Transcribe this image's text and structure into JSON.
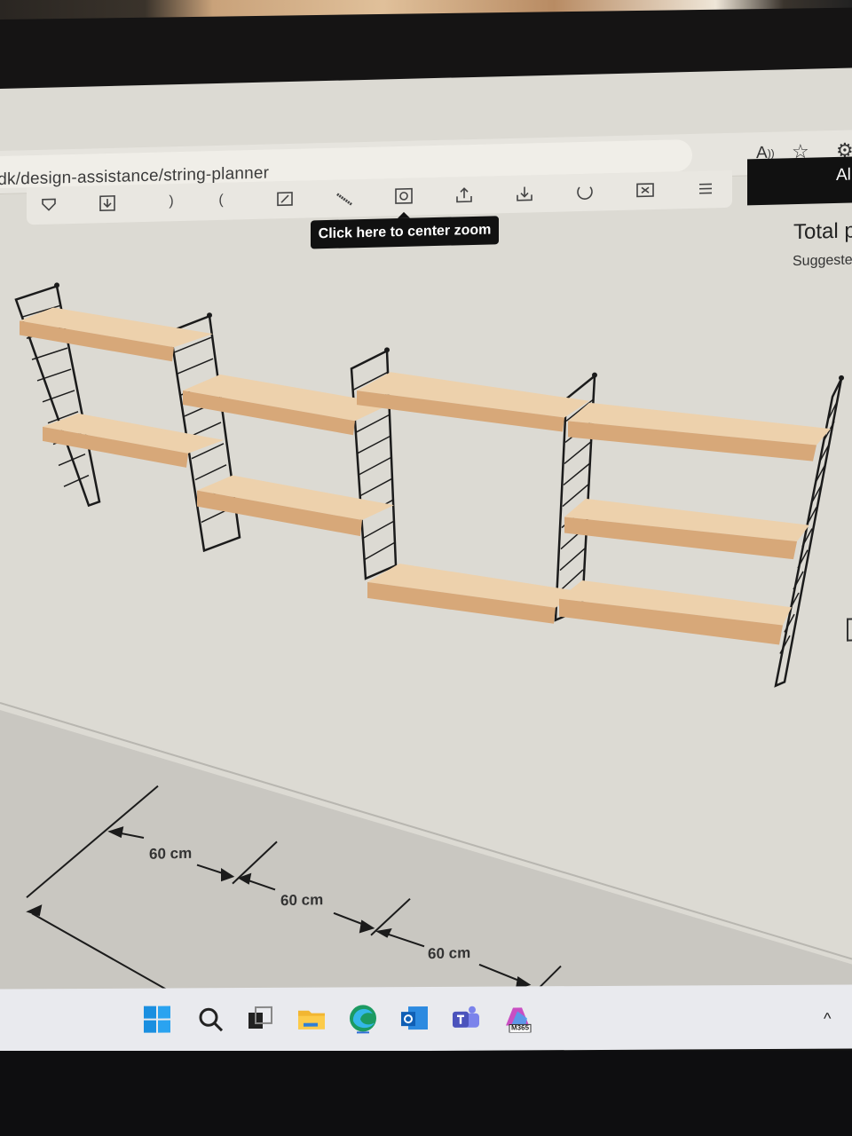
{
  "browser": {
    "url": "n-dk/design-assistance/string-planner",
    "icons": [
      "read-aloud-icon",
      "favorite-star-icon",
      "settings-icon"
    ]
  },
  "toolbar": {
    "tools": [
      "shelf-icon",
      "download-icon",
      "undo-icon",
      "redo-icon",
      "edit-icon",
      "measure-icon",
      "center-zoom-icon",
      "share-icon",
      "save-icon",
      "rotate-icon",
      "close-icon",
      "list-icon"
    ]
  },
  "tooltip": {
    "text": "Click here to center zoom"
  },
  "side_panel": {
    "button_text": "Al",
    "total_label": "Total p",
    "suggest_label": "Suggeste"
  },
  "dimensions": {
    "labels": [
      "60 cm",
      "60 cm",
      "60 cm"
    ]
  },
  "taskbar": {
    "apps": [
      "windows-start-icon",
      "search-icon",
      "task-view-icon",
      "file-explorer-icon",
      "edge-browser-icon",
      "outlook-icon",
      "teams-icon",
      "m365-icon"
    ],
    "m365_label": "M365"
  },
  "colors": {
    "shelf_wood": "#e2b98a",
    "shelf_edge": "#c99a68",
    "ladder": "#1b1b1b",
    "screen_bg": "#dcdad3"
  }
}
